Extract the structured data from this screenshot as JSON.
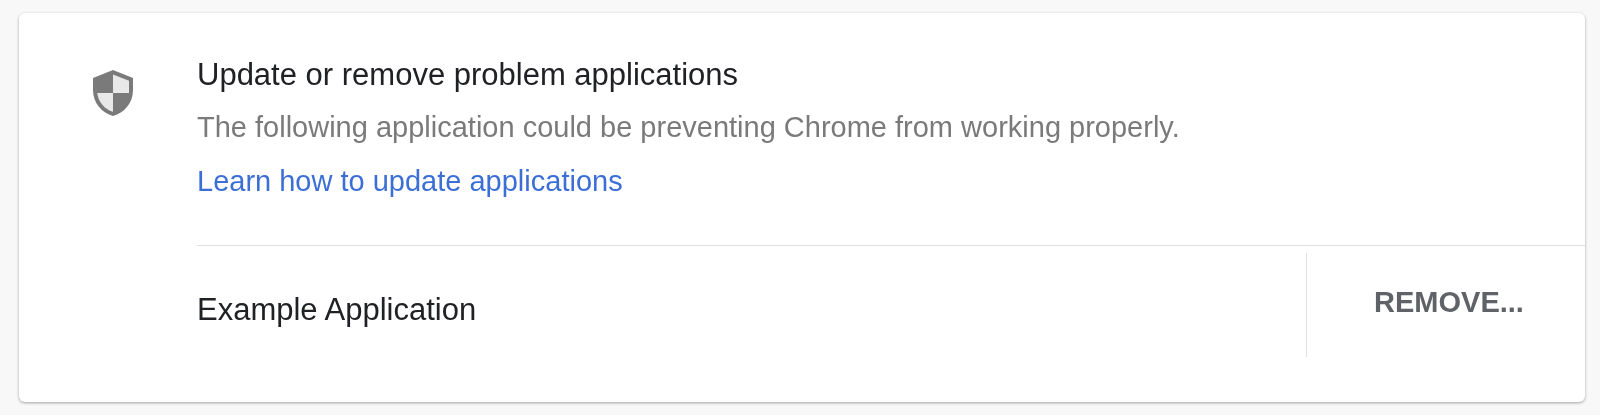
{
  "card": {
    "title": "Update or remove problem applications",
    "description": "The following application could be preventing Chrome from working properly.",
    "link": "Learn how to update applications"
  },
  "applications": [
    {
      "name": "Example Application",
      "action": "REMOVE..."
    }
  ]
}
